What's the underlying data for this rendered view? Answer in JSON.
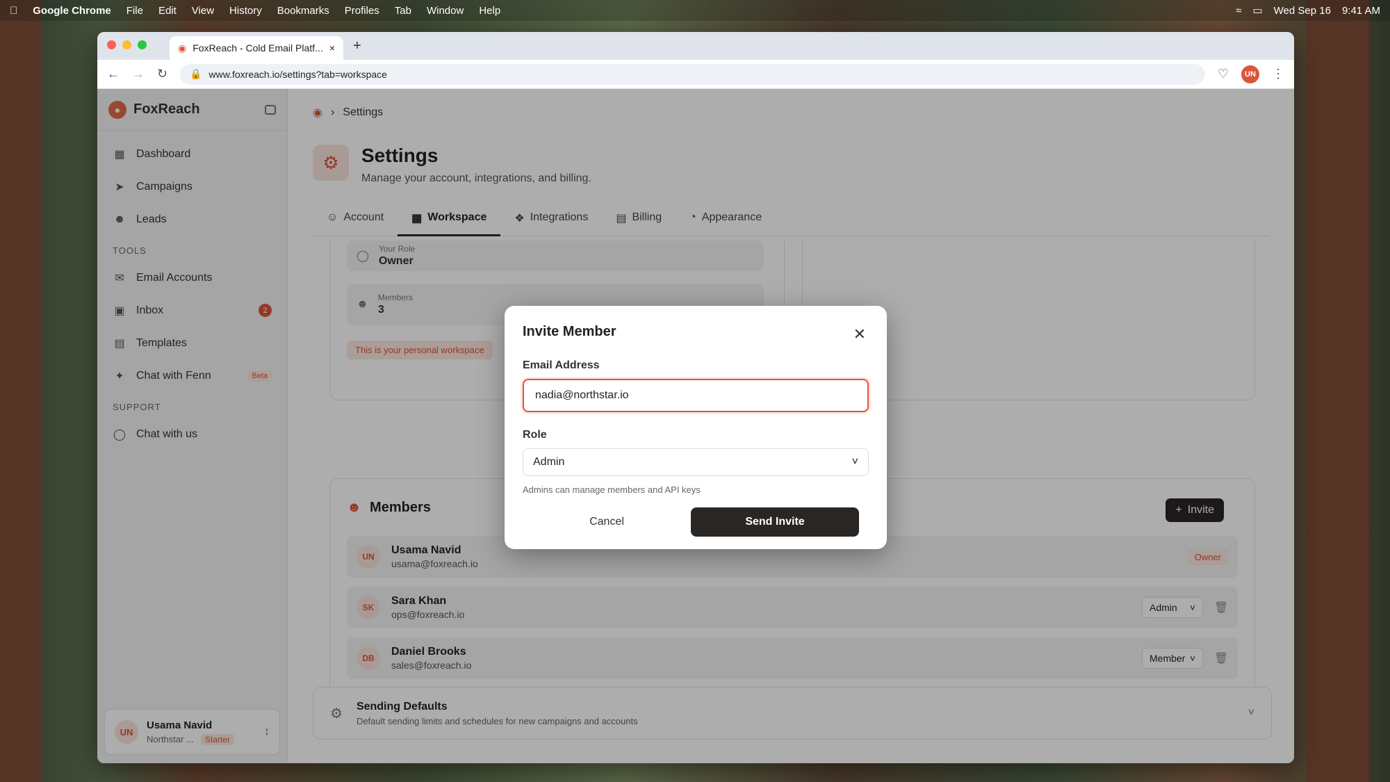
{
  "menubar": {
    "app": "Google Chrome",
    "items": [
      "File",
      "Edit",
      "View",
      "History",
      "Bookmarks",
      "Profiles",
      "Tab",
      "Window",
      "Help"
    ],
    "date": "Wed Sep 16",
    "time": "9:41 AM"
  },
  "browser": {
    "tab_title": "FoxReach - Cold Email Platf...",
    "url": "www.foxreach.io/settings?tab=workspace",
    "profile_initials": "UN"
  },
  "sidebar": {
    "brand": "FoxReach",
    "main_items": [
      "Dashboard",
      "Campaigns",
      "Leads"
    ],
    "tools_label": "TOOLS",
    "tools_items": [
      "Email Accounts",
      "Inbox",
      "Templates",
      "Chat with Fenn"
    ],
    "inbox_badge": "2",
    "beta_label": "Beta",
    "support_label": "SUPPORT",
    "support_items": [
      "Chat with us"
    ],
    "user": {
      "initials": "UN",
      "name": "Usama Navid",
      "workspace": "Northstar ...",
      "plan": "Starter"
    }
  },
  "page": {
    "breadcrumb": "Settings",
    "title": "Settings",
    "subtitle": "Manage your account, integrations, and billing.",
    "tabs": [
      "Account",
      "Workspace",
      "Integrations",
      "Billing",
      "Appearance"
    ],
    "role_label": "Your Role",
    "role_value": "Owner",
    "members_label": "Members",
    "members_value": "3",
    "personal_note": "This is your personal workspace",
    "members_title": "Members",
    "invite_label": "Invite",
    "members": [
      {
        "initials": "UN",
        "name": "Usama Navid",
        "email": "usama@foxreach.io",
        "role": "Owner"
      },
      {
        "initials": "SK",
        "name": "Sara Khan",
        "email": "ops@foxreach.io",
        "role": "Admin"
      },
      {
        "initials": "DB",
        "name": "Daniel Brooks",
        "email": "sales@foxreach.io",
        "role": "Member"
      }
    ],
    "sending_title": "Sending Defaults",
    "sending_sub": "Default sending limits and schedules for new campaigns and accounts"
  },
  "modal": {
    "title": "Invite Member",
    "email_label": "Email Address",
    "email_value": "nadia@northstar.io",
    "role_label": "Role",
    "role_value": "Admin",
    "hint": "Admins can manage members and API keys",
    "cancel": "Cancel",
    "send": "Send Invite"
  }
}
